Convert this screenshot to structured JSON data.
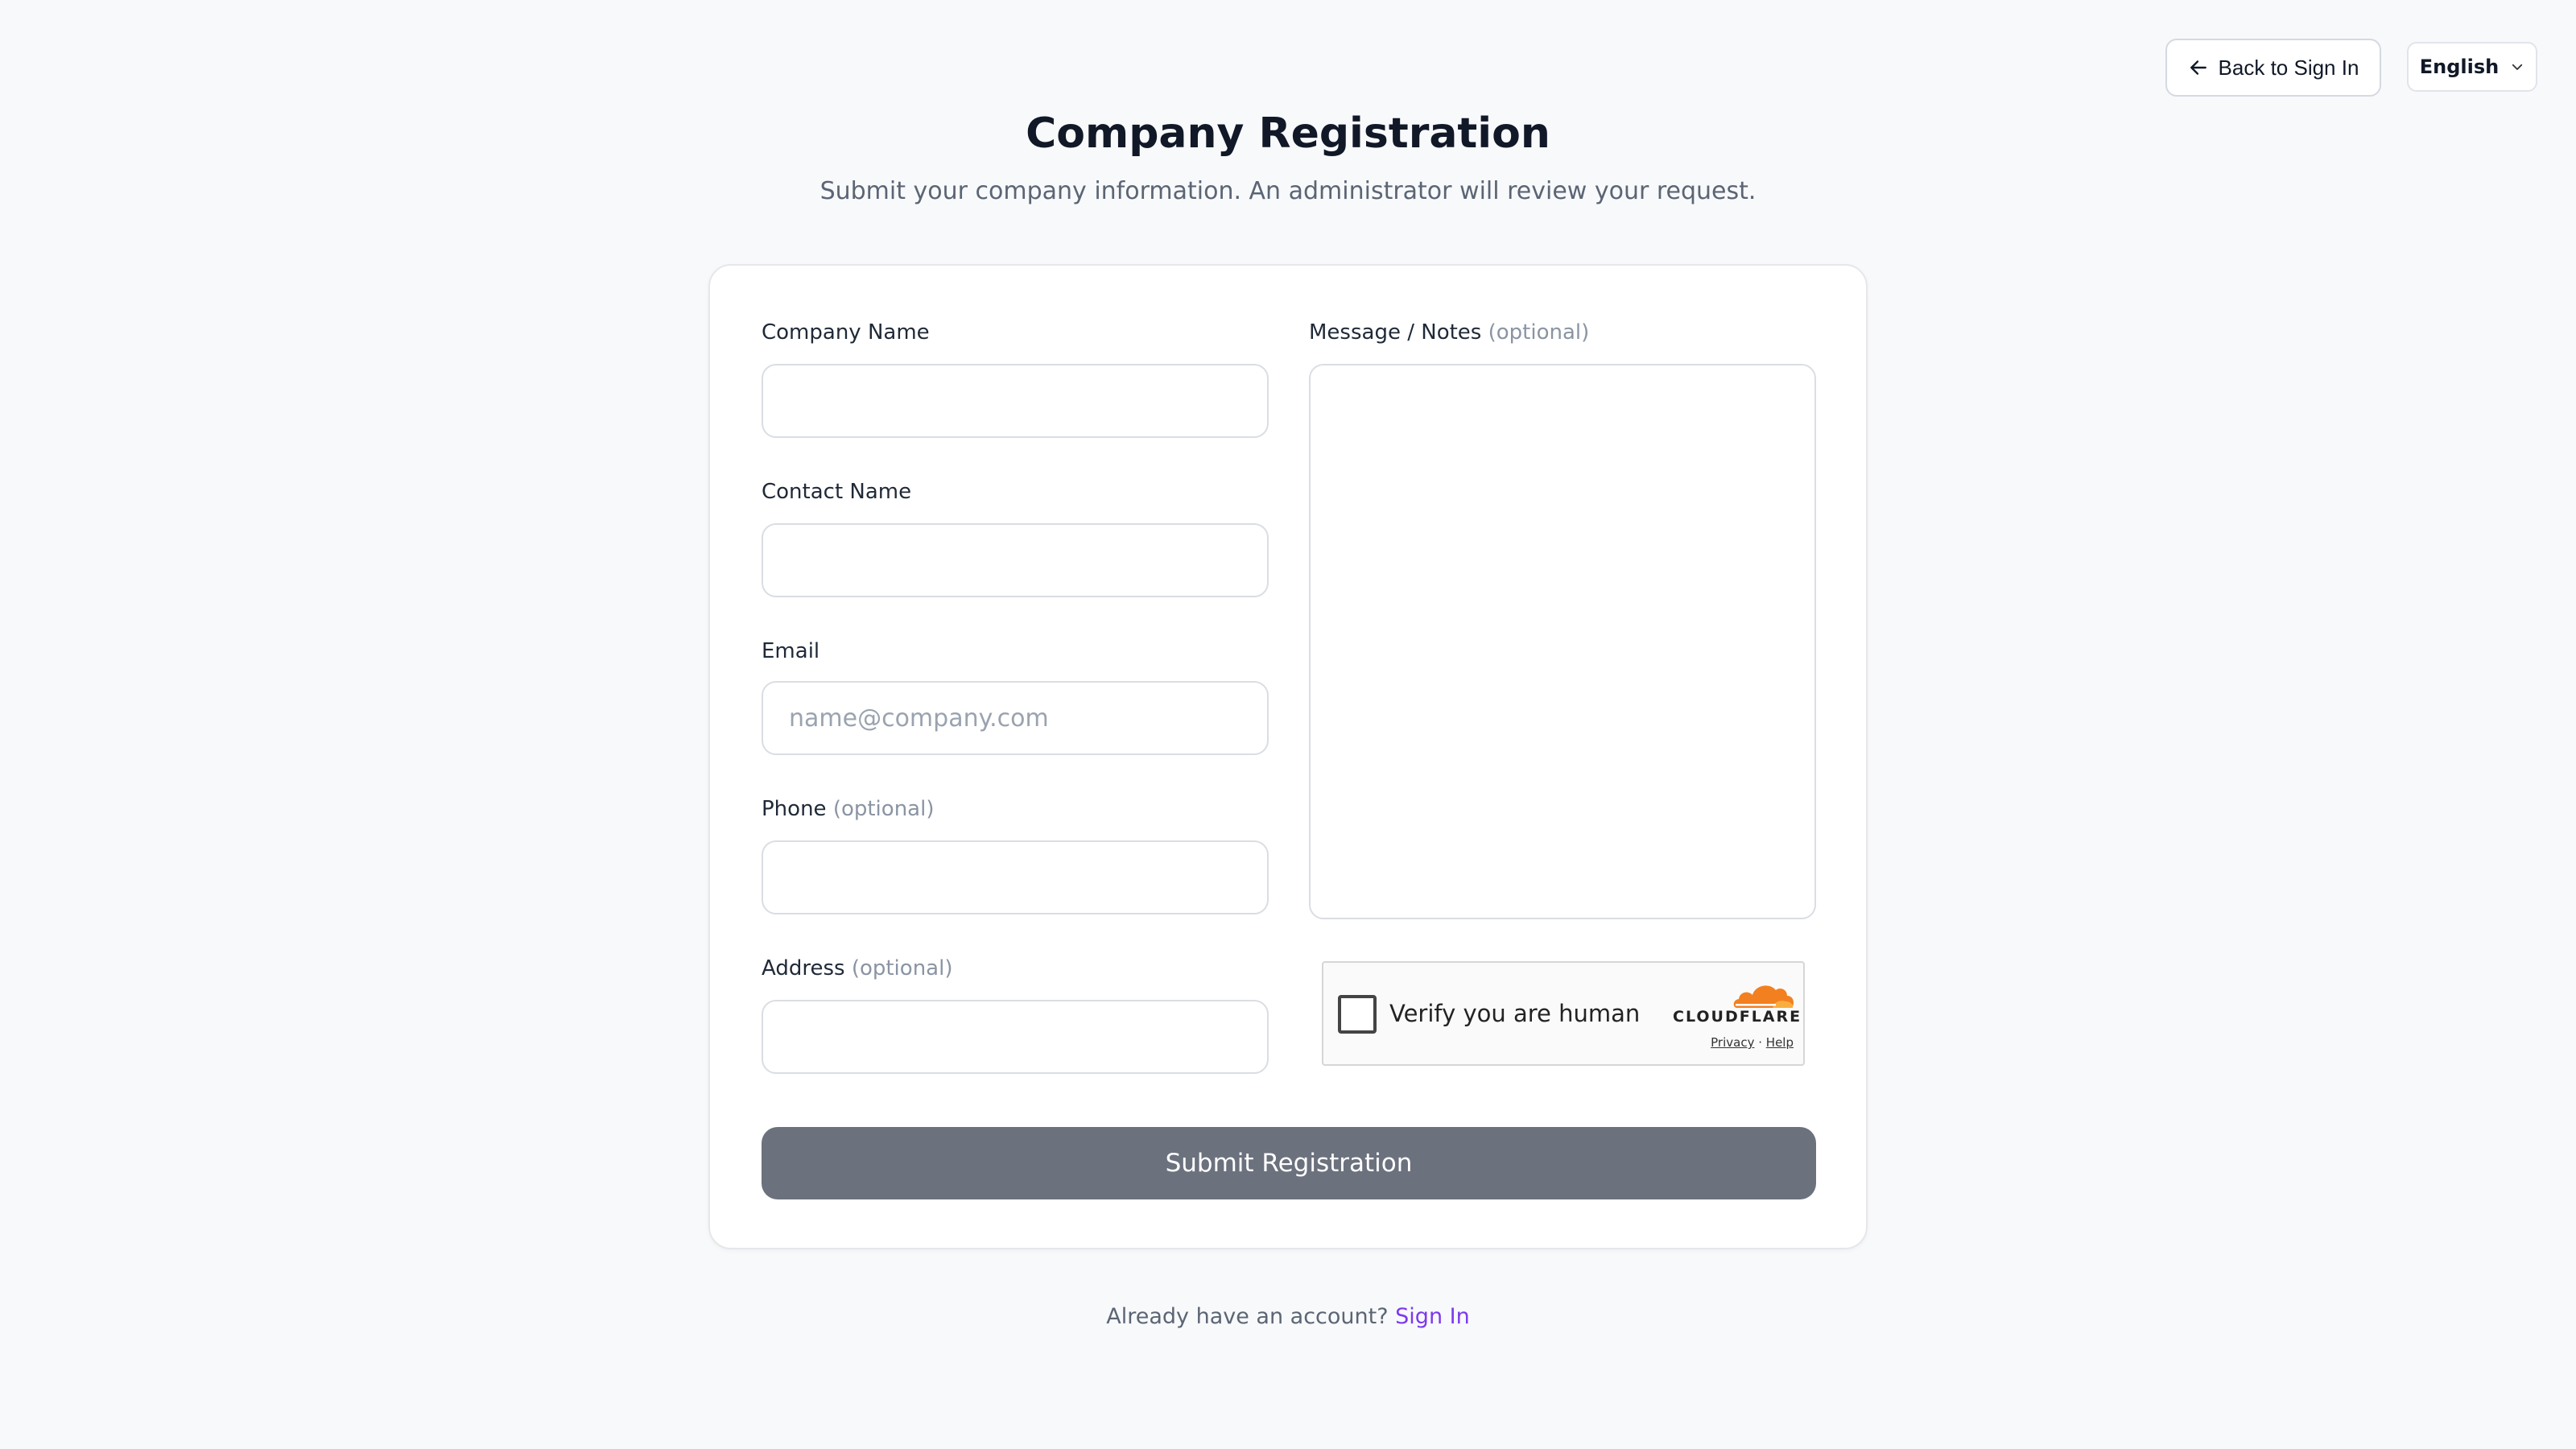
{
  "header": {
    "back_button_label": "Back to Sign In",
    "language_selected": "English",
    "back_icon": "arrow-left-icon",
    "dropdown_icon": "chevron-down-icon"
  },
  "page": {
    "title": "Company Registration",
    "subtitle": "Submit your company information. An administrator will review your request."
  },
  "form": {
    "company_name": {
      "label": "Company Name",
      "value": "",
      "placeholder": ""
    },
    "contact_name": {
      "label": "Contact Name",
      "value": "",
      "placeholder": ""
    },
    "email": {
      "label": "Email",
      "value": "",
      "placeholder": "name@company.com"
    },
    "phone": {
      "label": "Phone",
      "optional": "(optional)",
      "value": "",
      "placeholder": ""
    },
    "address": {
      "label": "Address",
      "optional": "(optional)",
      "value": "",
      "placeholder": ""
    },
    "message": {
      "label": "Message / Notes",
      "optional": "(optional)",
      "value": ""
    },
    "submit_label": "Submit Registration"
  },
  "captcha": {
    "text": "Verify you are human",
    "brand": "CLOUDFLARE",
    "privacy_label": "Privacy",
    "separator": "·",
    "help_label": "Help",
    "brand_color": "#f38020"
  },
  "footer": {
    "prompt": "Already have an account?",
    "sign_in_label": "Sign In",
    "link_color": "#7c3aed"
  },
  "colors": {
    "background": "#f8f9fb",
    "submit_button": "#6b717d"
  }
}
